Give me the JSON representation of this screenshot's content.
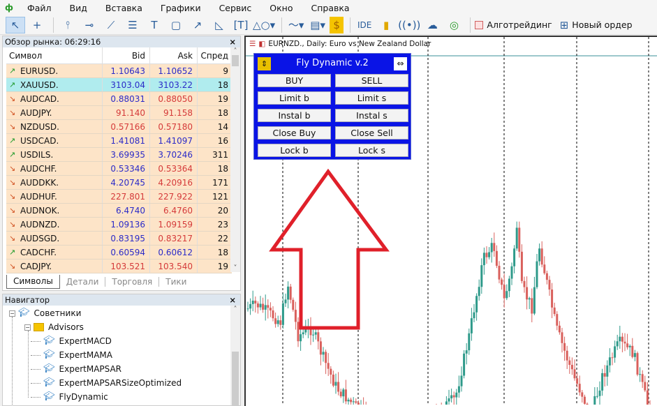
{
  "menu": {
    "items": [
      "Файл",
      "Вид",
      "Вставка",
      "Графики",
      "Сервис",
      "Окно",
      "Справка"
    ]
  },
  "toolbar": {
    "ide": "IDE",
    "algo": "Алготрейдинг",
    "new_order": "Новый ордер"
  },
  "market_watch": {
    "title": "Обзор рынка: 06:29:16",
    "columns": [
      "Символ",
      "Bid",
      "Ask",
      "Спред"
    ],
    "rows": [
      {
        "symbol": "EURUSD.",
        "bid": "1.10643",
        "ask": "1.10652",
        "spread": "9",
        "dir": "up",
        "bid_color": "blue",
        "ask_color": "blue"
      },
      {
        "symbol": "XAUUSD.",
        "bid": "3103.04",
        "ask": "3103.22",
        "spread": "18",
        "dir": "up",
        "bid_color": "blue",
        "ask_color": "blue",
        "selected": true
      },
      {
        "symbol": "AUDCAD.",
        "bid": "0.88031",
        "ask": "0.88050",
        "spread": "19",
        "dir": "down",
        "bid_color": "blue",
        "ask_color": "red"
      },
      {
        "symbol": "AUDJPY.",
        "bid": "91.140",
        "ask": "91.158",
        "spread": "18",
        "dir": "down",
        "bid_color": "red",
        "ask_color": "red"
      },
      {
        "symbol": "NZDUSD.",
        "bid": "0.57166",
        "ask": "0.57180",
        "spread": "14",
        "dir": "down",
        "bid_color": "red",
        "ask_color": "red"
      },
      {
        "symbol": "USDCAD.",
        "bid": "1.41081",
        "ask": "1.41097",
        "spread": "16",
        "dir": "up",
        "bid_color": "blue",
        "ask_color": "blue"
      },
      {
        "symbol": "USDILS.",
        "bid": "3.69935",
        "ask": "3.70246",
        "spread": "311",
        "dir": "up",
        "bid_color": "blue",
        "ask_color": "blue"
      },
      {
        "symbol": "AUDCHF.",
        "bid": "0.53346",
        "ask": "0.53364",
        "spread": "18",
        "dir": "down",
        "bid_color": "blue",
        "ask_color": "red"
      },
      {
        "symbol": "AUDDKK.",
        "bid": "4.20745",
        "ask": "4.20916",
        "spread": "171",
        "dir": "down",
        "bid_color": "blue",
        "ask_color": "red"
      },
      {
        "symbol": "AUDHUF.",
        "bid": "227.801",
        "ask": "227.922",
        "spread": "121",
        "dir": "down",
        "bid_color": "red",
        "ask_color": "red"
      },
      {
        "symbol": "AUDNOK.",
        "bid": "6.4740",
        "ask": "6.4760",
        "spread": "20",
        "dir": "down",
        "bid_color": "blue",
        "ask_color": "red"
      },
      {
        "symbol": "AUDNZD.",
        "bid": "1.09136",
        "ask": "1.09159",
        "spread": "23",
        "dir": "down",
        "bid_color": "blue",
        "ask_color": "red"
      },
      {
        "symbol": "AUDSGD.",
        "bid": "0.83195",
        "ask": "0.83217",
        "spread": "22",
        "dir": "down",
        "bid_color": "blue",
        "ask_color": "red"
      },
      {
        "symbol": "CADCHF.",
        "bid": "0.60594",
        "ask": "0.60612",
        "spread": "18",
        "dir": "up",
        "bid_color": "blue",
        "ask_color": "blue"
      },
      {
        "symbol": "CADJPY.",
        "bid": "103.521",
        "ask": "103.540",
        "spread": "19",
        "dir": "down",
        "bid_color": "red",
        "ask_color": "red"
      }
    ],
    "tabs": [
      "Символы",
      "Детали",
      "Торговля",
      "Тики"
    ]
  },
  "navigator": {
    "title": "Навигатор",
    "root": "Советники",
    "folder": "Advisors",
    "experts": [
      "ExpertMACD",
      "ExpertMAMA",
      "ExpertMAPSAR",
      "ExpertMAPSARSizeOptimized",
      "FlyDynamic"
    ]
  },
  "chart": {
    "title": "EURNZD., Daily:  Euro vs New Zealand Dollar"
  },
  "panel": {
    "title": "Fly Dynamic v.2",
    "buttons": [
      [
        "BUY",
        "SELL"
      ],
      [
        "Limit b",
        "Limit s"
      ],
      [
        "Instal b",
        "Instal s"
      ],
      [
        "Close Buy",
        "Close Sell"
      ],
      [
        "Lock b",
        "Lock s"
      ]
    ]
  },
  "colors": {
    "blue": "#2b2bc8",
    "red": "#d53a3a",
    "panel": "#0a14e6",
    "bull": "#2e9a8a",
    "bear": "#d9605c",
    "arrow": "#e0202a"
  }
}
